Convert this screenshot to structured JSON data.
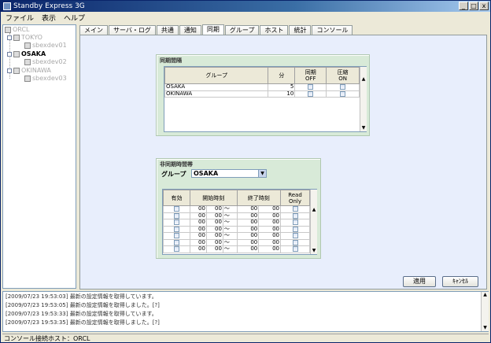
{
  "window": {
    "title": "Standby Express 3G",
    "min": "_",
    "max": "□",
    "close": "x"
  },
  "menu": [
    "ファイル",
    "表示",
    "ヘルプ"
  ],
  "tree": {
    "root": "ORCL",
    "nodes": [
      {
        "label": "TOKYO",
        "child": "sbexdev01"
      },
      {
        "label": "OSAKA",
        "child": "sbexdev02"
      },
      {
        "label": "OKINAWA",
        "child": "sbexdev03"
      }
    ]
  },
  "tabs": [
    "メイン",
    "サーバ・ログ",
    "共通",
    "通知",
    "同期",
    "グループ",
    "ホスト",
    "統計",
    "コンソール"
  ],
  "sync_interval": {
    "title": "同期間隔",
    "headers": {
      "group": "グループ",
      "minutes": "分",
      "sync_off_1": "同期",
      "sync_off_2": "OFF",
      "compress_1": "圧縮",
      "compress_2": "ON"
    },
    "rows": [
      {
        "group": "OSAKA",
        "minutes": "5"
      },
      {
        "group": "OKINAWA",
        "minutes": "10"
      }
    ]
  },
  "async_time": {
    "title": "非同期時間帯",
    "group_label": "グループ",
    "group_value": "OSAKA",
    "headers": {
      "enabled": "有効",
      "start": "開始時刻",
      "end": "終了時刻",
      "readonly_1": "Read",
      "readonly_2": "Only"
    },
    "row_values": {
      "hh": "00",
      "mm": "00",
      "sep": "～"
    }
  },
  "buttons": {
    "apply": "適用",
    "cancel": "ｷｬﾝｾﾙ"
  },
  "log": [
    "[2009/07/23 19:53:03] 最新の設定情報を取得しています。",
    "[2009/07/23 19:53:05] 最新の設定情報を取得しました。[?]",
    "[2009/07/23 19:53:33] 最新の設定情報を取得しています。",
    "[2009/07/23 19:53:35] 最新の設定情報を取得しました。[?]"
  ],
  "status": "コンソール接続ホスト：ORCL"
}
